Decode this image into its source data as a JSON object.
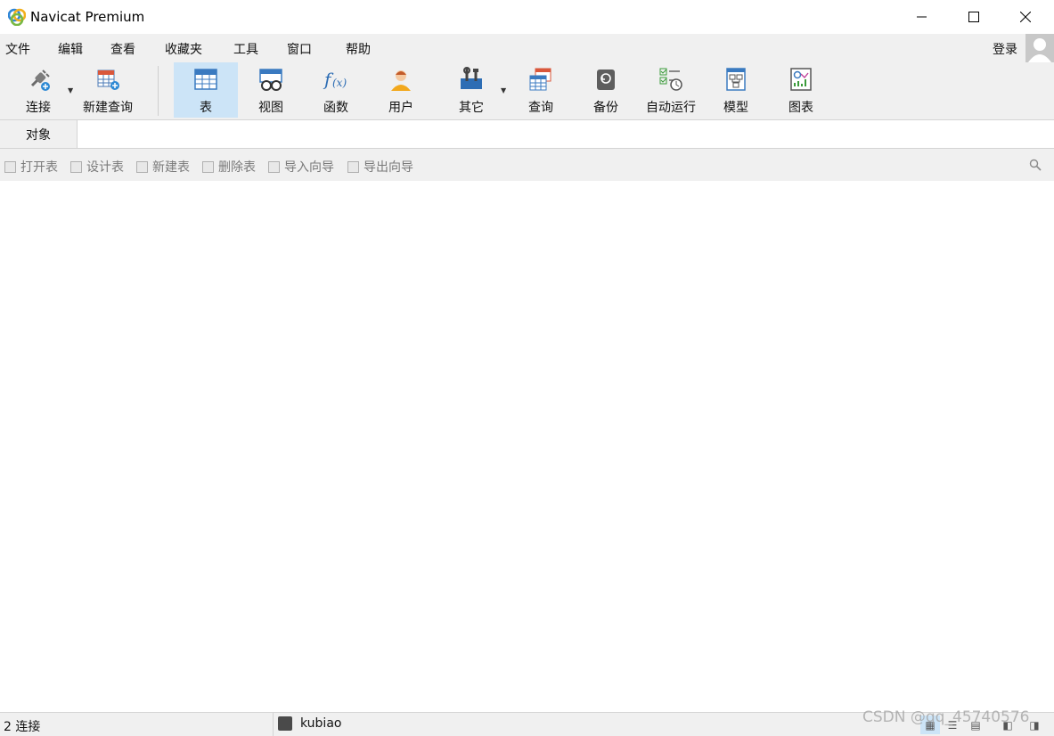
{
  "window": {
    "title": "Navicat Premium"
  },
  "menu": {
    "items": [
      "文件",
      "编辑",
      "查看",
      "收藏夹",
      "工具",
      "窗口",
      "帮助"
    ],
    "login": "登录"
  },
  "toolbar": {
    "buttons": [
      {
        "label": "连接",
        "icon": "plug-icon"
      },
      {
        "label": "新建查询",
        "icon": "new-query-icon"
      },
      {
        "label": "表",
        "icon": "table-icon",
        "active": true
      },
      {
        "label": "视图",
        "icon": "view-icon"
      },
      {
        "label": "函数",
        "icon": "function-icon"
      },
      {
        "label": "用户",
        "icon": "user-icon"
      },
      {
        "label": "其它",
        "icon": "tools-icon"
      },
      {
        "label": "查询",
        "icon": "query-icon"
      },
      {
        "label": "备份",
        "icon": "backup-icon"
      },
      {
        "label": "自动运行",
        "icon": "autorun-icon"
      },
      {
        "label": "模型",
        "icon": "model-icon"
      },
      {
        "label": "图表",
        "icon": "chart-icon"
      }
    ]
  },
  "tabs": {
    "object": "对象"
  },
  "object_toolbar": {
    "items": [
      "打开表",
      "设计表",
      "新建表",
      "删除表",
      "导入向导",
      "导出向导"
    ]
  },
  "status": {
    "connections": "2 连接",
    "current_connection": "kubiao"
  },
  "watermark": "CSDN @qq_45740576",
  "colors": {
    "active_bg": "#cce4f7",
    "chrome_bg": "#f0f0f0"
  }
}
